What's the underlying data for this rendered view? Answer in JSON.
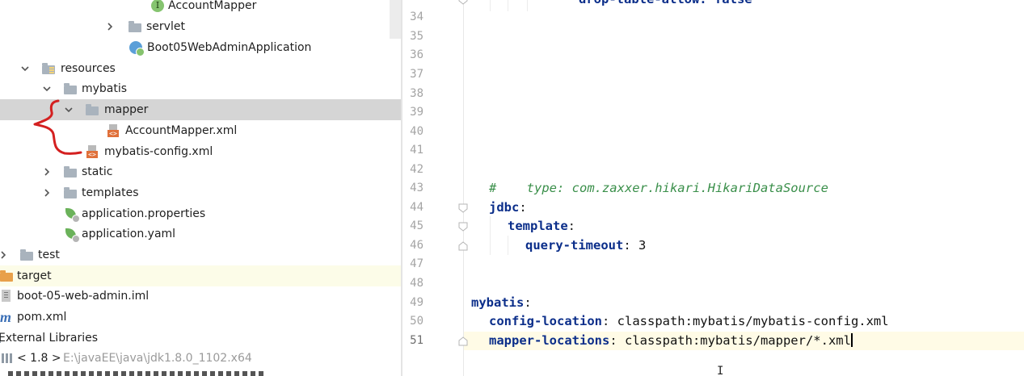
{
  "tree": {
    "items": [
      {
        "label": "AccountMapper",
        "icon": "interface-icon"
      },
      {
        "label": "servlet",
        "icon": "package-icon"
      },
      {
        "label": "Boot05WebAdminApplication",
        "icon": "spring-boot-class-icon"
      },
      {
        "label": "resources",
        "icon": "resources-folder-icon"
      },
      {
        "label": "mybatis",
        "icon": "folder-icon"
      },
      {
        "label": "mapper",
        "icon": "folder-icon"
      },
      {
        "label": "AccountMapper.xml",
        "icon": "xml-file-icon"
      },
      {
        "label": "mybatis-config.xml",
        "icon": "xml-file-icon"
      },
      {
        "label": "static",
        "icon": "folder-icon"
      },
      {
        "label": "templates",
        "icon": "folder-icon"
      },
      {
        "label": "application.properties",
        "icon": "spring-config-icon"
      },
      {
        "label": "application.yaml",
        "icon": "spring-config-icon"
      },
      {
        "label": "test",
        "icon": "folder-icon"
      },
      {
        "label": "target",
        "icon": "orange-folder-icon"
      },
      {
        "label": "boot-05-web-admin.iml",
        "icon": "iml-file-icon"
      },
      {
        "label": "pom.xml",
        "icon": "maven-icon"
      },
      {
        "label": "External Libraries",
        "icon": "libraries-icon"
      },
      {
        "label": "< 1.8 >",
        "icon": "jdk-icon",
        "detail": "E:\\javaEE\\java\\jdk1.8.0_1102.x64"
      }
    ]
  },
  "editor": {
    "line_numbers": [
      "34",
      "35",
      "36",
      "37",
      "38",
      "39",
      "40",
      "41",
      "42",
      "43",
      "44",
      "45",
      "46",
      "47",
      "48",
      "49",
      "50",
      "51"
    ],
    "current_line": "51",
    "lines": {
      "l33_partial": "drop-table-allow: false",
      "l43_comment": "#    type: com.zaxxer.hikari.HikariDataSource",
      "l44_key": "jdbc",
      "l45_key": "template",
      "l46_key": "query-timeout",
      "l46_value": "3",
      "l49_key": "mybatis",
      "l50_key": "config-location",
      "l50_value": "classpath:mybatis/mybatis-config.xml",
      "l51_key": "mapper-locations",
      "l51_value": "classpath:mybatis/mapper/*.xml"
    },
    "colors": {
      "key": "#0b2e8a",
      "comment": "#3a8f4a",
      "current_line_bg": "#fffbe6",
      "selected_row_bg": "#d5d5d5",
      "annotation": "#d42020"
    }
  }
}
